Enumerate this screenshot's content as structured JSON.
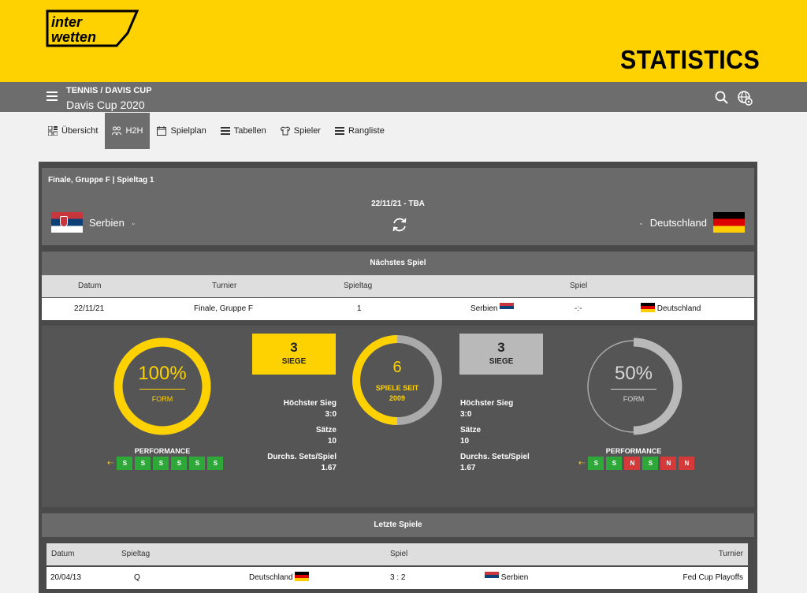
{
  "header": {
    "logo_text": [
      "inter",
      "wetten"
    ],
    "title": "STATISTICS",
    "breadcrumb": "TENNIS / DAVIS CUP",
    "competition": "Davis Cup 2020",
    "icons": [
      "hamburger-icon",
      "search-icon",
      "globe-settings-icon"
    ]
  },
  "tabs": [
    {
      "label": "Übersicht",
      "icon": "overview-icon",
      "active": false
    },
    {
      "label": "H2H",
      "icon": "h2h-icon",
      "active": true
    },
    {
      "label": "Spielplan",
      "icon": "calendar-icon",
      "active": false
    },
    {
      "label": "Tabellen",
      "icon": "table-icon",
      "active": false
    },
    {
      "label": "Spieler",
      "icon": "shirt-icon",
      "active": false
    },
    {
      "label": "Rangliste",
      "icon": "ranking-icon",
      "active": false
    }
  ],
  "match": {
    "round": "Finale, Gruppe F | Spieltag 1",
    "date": "22/11/21 - TBA",
    "home": "Serbien",
    "away": "Deutschland"
  },
  "next_game": {
    "title": "Nächstes Spiel",
    "columns": [
      "Datum",
      "Turnier",
      "Spieltag",
      "Spiel"
    ],
    "row": {
      "datum": "22/11/21",
      "turnier": "Finale, Gruppe F",
      "spieltag": "1",
      "home": "Serbien",
      "score": "-:-",
      "away": "Deutschland"
    }
  },
  "stats": {
    "home": {
      "form_value": "100%",
      "form_label": "FORM",
      "form_fraction": 1.0,
      "wins": "3",
      "wins_label": "SIEGE",
      "performance_label": "PERFORMANCE",
      "performance": [
        "S",
        "S",
        "S",
        "S",
        "S",
        "S"
      ],
      "hoechster_sieg_label": "Höchster Sieg",
      "hoechster_sieg": "3:0",
      "saetze_label": "Sätze",
      "saetze": "10",
      "avg_label": "Durchs. Sets/Spiel",
      "avg": "1.67"
    },
    "center": {
      "value": "6",
      "label_line1": "SPIELE SEIT",
      "label_line2": "2009",
      "home_fraction": 0.5
    },
    "away": {
      "form_value": "50%",
      "form_label": "FORM",
      "form_fraction": 0.5,
      "wins": "3",
      "wins_label": "SIEGE",
      "performance_label": "PERFORMANCE",
      "performance": [
        "S",
        "S",
        "N",
        "S",
        "N",
        "N"
      ],
      "hoechster_sieg_label": "Höchster Sieg",
      "hoechster_sieg": "3:0",
      "saetze_label": "Sätze",
      "saetze": "10",
      "avg_label": "Durchs. Sets/Spiel",
      "avg": "1.67"
    }
  },
  "last_games": {
    "title": "Letzte Spiele",
    "columns": [
      "Datum",
      "Spieltag",
      "Spiel",
      "Turnier"
    ],
    "rows": [
      {
        "datum": "20/04/13",
        "spieltag": "Q",
        "home": "Deutschland",
        "score": "3 : 2",
        "away": "Serbien",
        "turnier": "Fed Cup Playoffs"
      }
    ]
  },
  "colors": {
    "brand_yellow": "#fed200",
    "win_green": "#2fa83a",
    "loss_red": "#d43a3a",
    "header_grey": "#6d6d6d"
  }
}
